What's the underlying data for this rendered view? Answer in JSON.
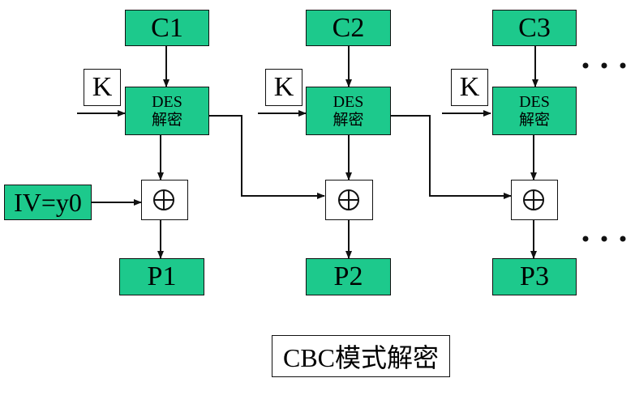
{
  "ciphertext_labels": [
    "C1",
    "C2",
    "C3"
  ],
  "plaintext_labels": [
    "P1",
    "P2",
    "P3"
  ],
  "key_label": "K",
  "des_label_line1": "DES",
  "des_label_line2": "解密",
  "iv_label": "IV=y0",
  "xor_symbol": "⊕",
  "caption": "CBC模式解密",
  "colors": {
    "box_fill": "#1dc98c",
    "stroke": "#111111"
  }
}
